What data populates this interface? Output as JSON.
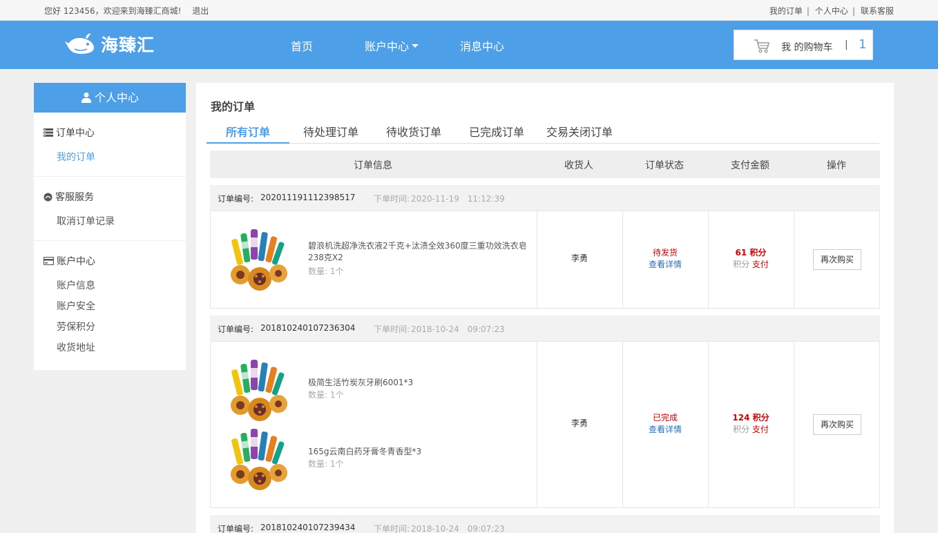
{
  "topbar": {
    "greeting": "您好 123456，欢迎来到海臻汇商城!",
    "logout": "退出",
    "links": [
      "我的订单",
      "个人中心",
      "联系客服"
    ],
    "separator": "|"
  },
  "header": {
    "brand": "海臻汇",
    "nav": {
      "home": "首页",
      "account": "账户中心",
      "messages": "消息中心"
    },
    "cart": {
      "label": "我 的购物车",
      "separator": "|",
      "count": "1"
    },
    "colors": {
      "primary": "#4d9fe8",
      "alert": "#cc0000"
    }
  },
  "sidebar": {
    "title": "个人中心",
    "groups": [
      {
        "title": "订单中心",
        "icon": "list-icon",
        "items": [
          "我的订单"
        ]
      },
      {
        "title": "客服服务",
        "icon": "service-icon",
        "items": [
          "取消订单记录"
        ]
      },
      {
        "title": "账户中心",
        "icon": "card-icon",
        "items": [
          "账户信息",
          "账户安全",
          "劳保积分",
          "收货地址"
        ]
      }
    ]
  },
  "main": {
    "title": "我的订单",
    "tabs": [
      "所有订单",
      "待处理订单",
      "待收货订单",
      "已完成订单",
      "交易关闭订单"
    ],
    "columns": [
      "订单信息",
      "收货人",
      "订单状态",
      "支付金额",
      "操作"
    ]
  },
  "labels": {
    "order_no": "订单编号:",
    "order_time": "下单时间:",
    "qty": "数量: 1个",
    "detail": "查看详情",
    "points": "积分",
    "pay": "支付",
    "rebuy": "再次购买"
  },
  "orders": [
    {
      "no": "202011191112398517",
      "time": "2020-11-19　11:12:39",
      "products": [
        {
          "name": "碧浪机洗超净洗衣液2千克+汰渍全效360度三重功效洗衣皂238克X2"
        }
      ],
      "receiver": "李勇",
      "status": "待发货",
      "amount": "61 积分"
    },
    {
      "no": "201810240107236304",
      "time": "2018-10-24　09:07:23",
      "products": [
        {
          "name": "极简生活竹炭灰牙刷6001*3"
        },
        {
          "name": "165g云南白药牙膏冬青香型*3"
        }
      ],
      "receiver": "李勇",
      "status": "已完成",
      "amount": "124 积分"
    },
    {
      "no": "201810240107239434",
      "time": "2018-10-24　09:07:23"
    }
  ]
}
